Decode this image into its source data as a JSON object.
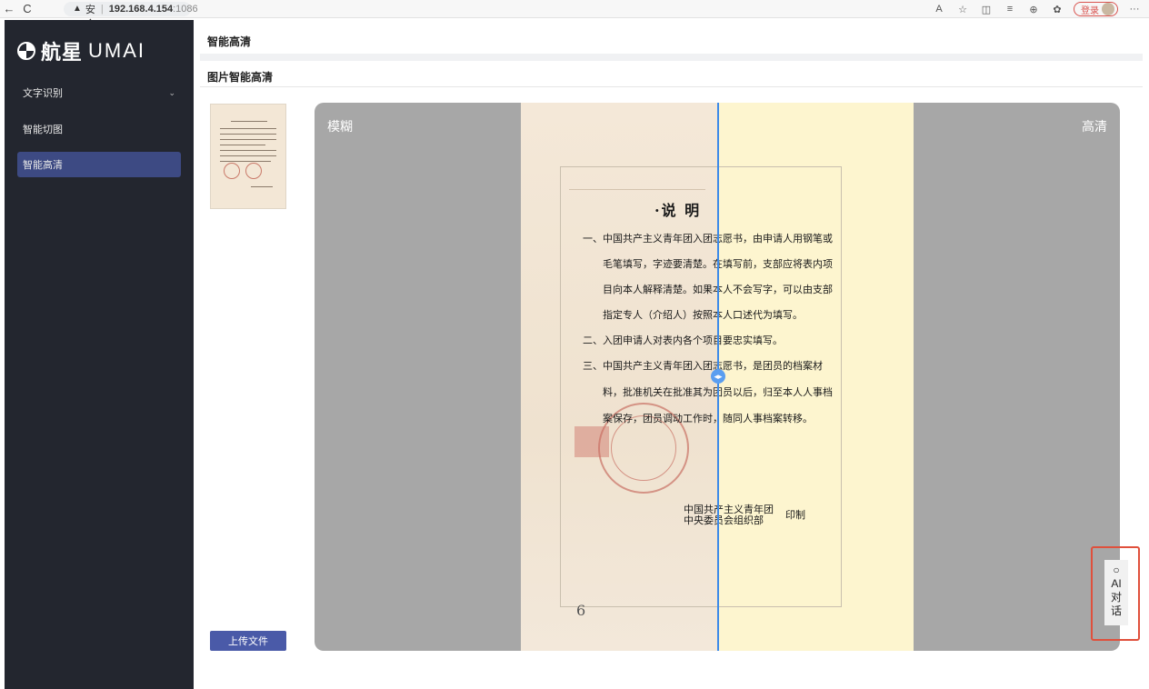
{
  "browser": {
    "back_icon": "←",
    "reload_icon": "C",
    "insecure_label": "不安全",
    "host": "192.168.4.154",
    "port": ":1086",
    "login_label": "登录",
    "more_icon": "···"
  },
  "sidebar": {
    "logo_cn": "航星",
    "logo_en": "UMAI",
    "items": [
      {
        "label": "文字识别",
        "has_chevron": true
      },
      {
        "label": "智能切图"
      },
      {
        "label": "智能高清",
        "active": true
      }
    ]
  },
  "header": {
    "page_title": "智能高清",
    "section_title": "图片智能高清"
  },
  "upload": {
    "label": "上传文件"
  },
  "viewer": {
    "label_left": "模糊",
    "label_right": "高清"
  },
  "document": {
    "heading": "·说 明",
    "lines": [
      "一、中国共产主义青年团入团志愿书，由申请人用钢笔或",
      "毛笔填写，字迹要清楚。在填写前，支部应将表内项",
      "目向本人解释清楚。如果本人不会写字，可以由支部",
      "指定专人（介绍人）按照本人口述代为填写。",
      "二、入团申请人对表内各个项目要忠实填写。",
      "三、中国共产主义青年团入团志愿书，是团员的档案材",
      "料，批准机关在批准其为团员以后，归至本人人事档",
      "案保存，团员调动工作时，随同人事档案转移。"
    ],
    "org_line1": "中国共产主义青年团",
    "org_line2": "中央委员会组织部",
    "print_label": "印制",
    "page_number": "6"
  },
  "ai_chat": {
    "icon": "○",
    "label": "AI对话"
  }
}
